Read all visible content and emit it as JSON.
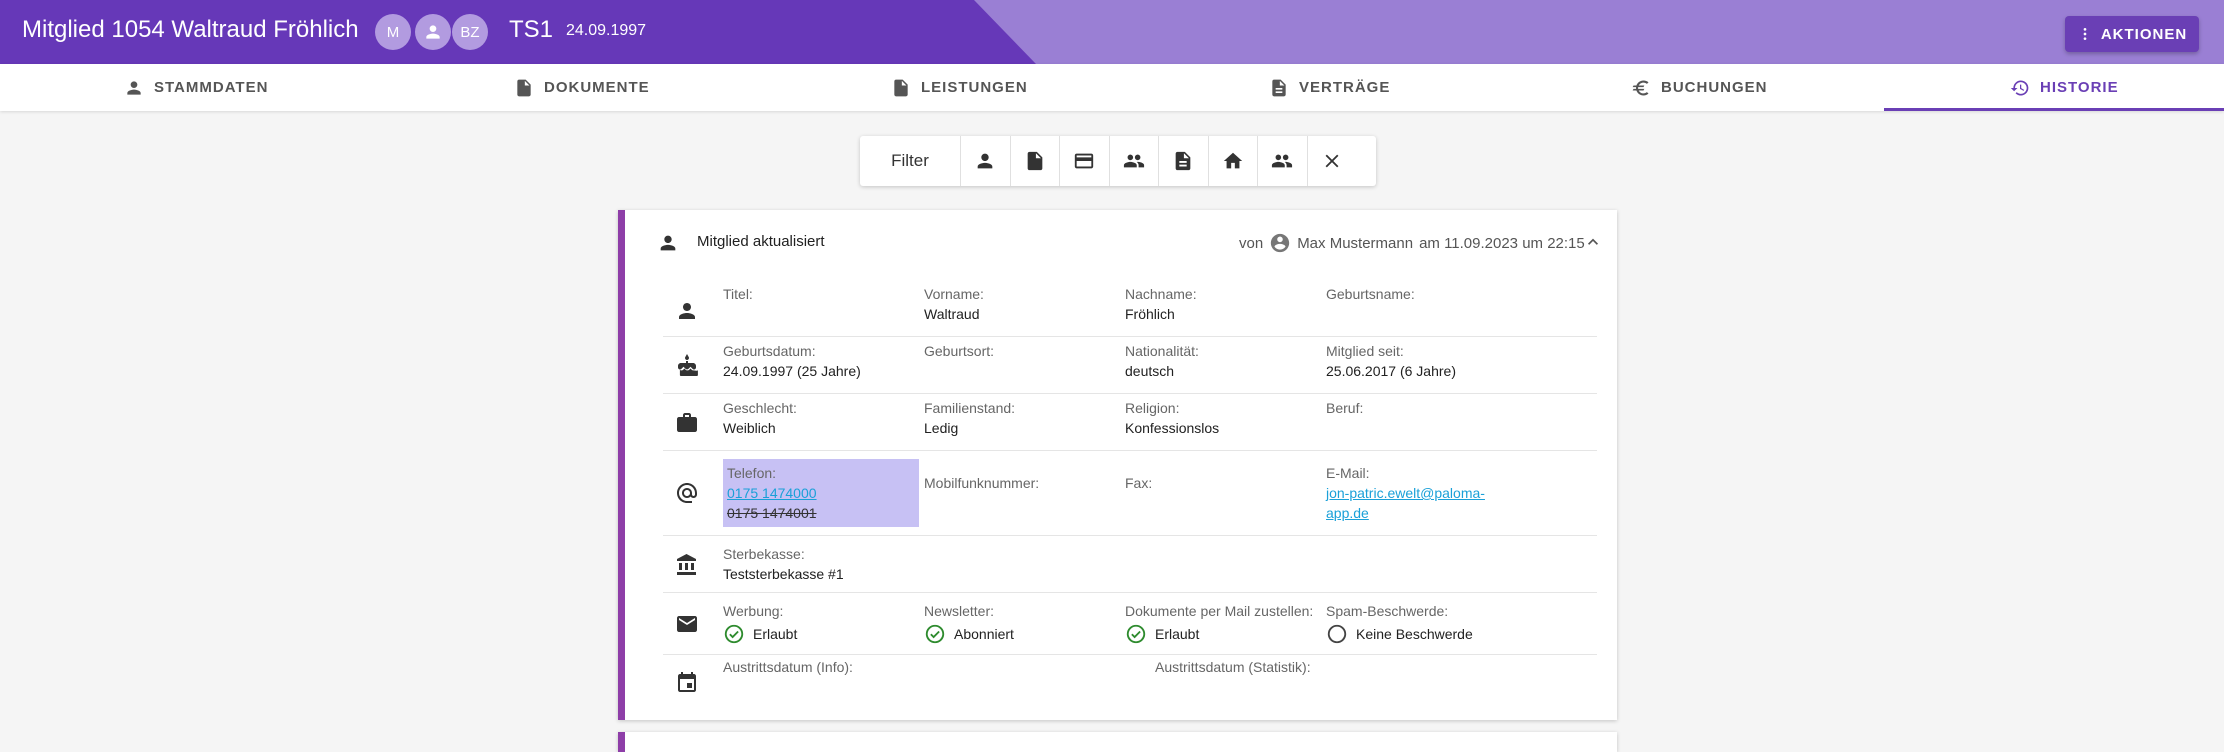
{
  "header": {
    "title": "Mitglied 1054 Waltraud Fröhlich",
    "avatars": [
      "M",
      "",
      "BZ"
    ],
    "code": "TS1",
    "date": "24.09.1997",
    "actions_label": "AKTIONEN"
  },
  "tabs": [
    {
      "label": "STAMMDATEN",
      "icon": "person-icon"
    },
    {
      "label": "DOKUMENTE",
      "icon": "document-icon"
    },
    {
      "label": "LEISTUNGEN",
      "icon": "document-icon"
    },
    {
      "label": "VERTRÄGE",
      "icon": "contract-icon"
    },
    {
      "label": "BUCHUNGEN",
      "icon": "euro-icon"
    },
    {
      "label": "HISTORIE",
      "icon": "history-icon",
      "active": true
    }
  ],
  "filter": {
    "label": "Filter",
    "buttons": [
      "person-icon",
      "document-icon",
      "credit-card-icon",
      "group-icon",
      "contract-icon",
      "home-icon",
      "group-icon",
      "close-icon"
    ]
  },
  "entry": {
    "title": "Mitglied aktualisiert",
    "meta_prefix": "von",
    "user": "Max Mustermann",
    "meta_suffix": "am 11.09.2023 um 22:15",
    "rows": {
      "name": {
        "titel_label": "Titel:",
        "vorname_label": "Vorname:",
        "vorname": "Waltraud",
        "nachname_label": "Nachname:",
        "nachname": "Fröhlich",
        "geburtsname_label": "Geburtsname:"
      },
      "birth": {
        "geburtsdatum_label": "Geburtsdatum:",
        "geburtsdatum": "24.09.1997 (25 Jahre)",
        "geburtsort_label": "Geburtsort:",
        "nationalitaet_label": "Nationalität:",
        "nationalitaet": "deutsch",
        "mitglied_seit_label": "Mitglied seit:",
        "mitglied_seit": "25.06.2017 (6 Jahre)"
      },
      "personal": {
        "geschlecht_label": "Geschlecht:",
        "geschlecht": "Weiblich",
        "familienstand_label": "Familienstand:",
        "familienstand": "Ledig",
        "religion_label": "Religion:",
        "religion": "Konfessionslos",
        "beruf_label": "Beruf:"
      },
      "contact": {
        "telefon_label": "Telefon:",
        "telefon_new": "0175 1474000",
        "telefon_old": "0175 1474001",
        "mobil_label": "Mobilfunknummer:",
        "fax_label": "Fax:",
        "email_label": "E-Mail:",
        "email_line1": "jon-patric.ewelt@paloma-",
        "email_line2": "app.de"
      },
      "sterbekasse": {
        "label": "Sterbekasse:",
        "value": "Teststerbekasse #1"
      },
      "consent": {
        "werbung_label": "Werbung:",
        "werbung": "Erlaubt",
        "newsletter_label": "Newsletter:",
        "newsletter": "Abonniert",
        "dokumente_label": "Dokumente per Mail zustellen:",
        "dokumente": "Erlaubt",
        "spam_label": "Spam-Beschwerde:",
        "spam": "Keine Beschwerde"
      },
      "exit": {
        "info_label": "Austrittsdatum (Info):",
        "statistik_label": "Austrittsdatum (Statistik):"
      }
    }
  },
  "colors": {
    "header_dark": "#6638b8",
    "header_light": "#9a7fd4",
    "accent": "#6a3fb5",
    "card_border": "#8e3ea8",
    "check_green": "#2e8b2e",
    "highlight": "#c7c1f4",
    "link": "#1aa0d8"
  }
}
